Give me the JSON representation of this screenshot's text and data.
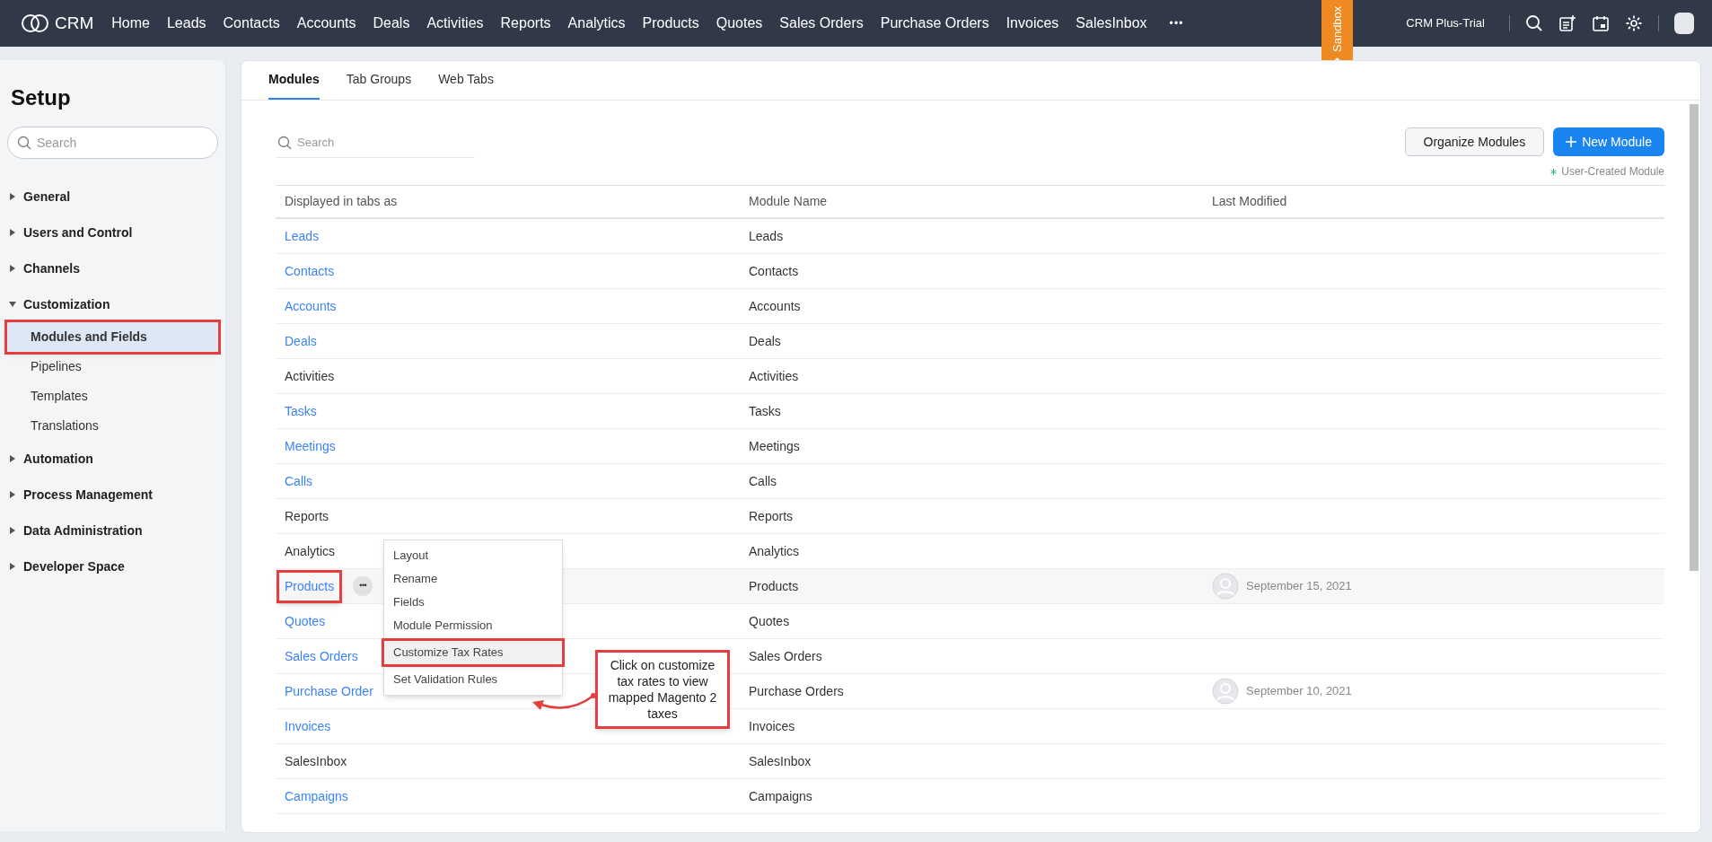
{
  "topbar": {
    "brand": "CRM",
    "nav": [
      "Home",
      "Leads",
      "Contacts",
      "Accounts",
      "Deals",
      "Activities",
      "Reports",
      "Analytics",
      "Products",
      "Quotes",
      "Sales Orders",
      "Purchase Orders",
      "Invoices",
      "SalesInbox"
    ],
    "more": "•••",
    "ribbon": "Sandbox",
    "plan": "CRM Plus-Trial"
  },
  "sidebar": {
    "title": "Setup",
    "search": {
      "placeholder": "Search"
    },
    "sections": [
      {
        "label": "General",
        "expanded": false
      },
      {
        "label": "Users and Control",
        "expanded": false
      },
      {
        "label": "Channels",
        "expanded": false
      },
      {
        "label": "Customization",
        "expanded": true,
        "children": [
          {
            "label": "Modules and Fields",
            "selected": true,
            "annotated": true
          },
          {
            "label": "Pipelines",
            "selected": false,
            "annotated": false
          },
          {
            "label": "Templates",
            "selected": false,
            "annotated": false
          },
          {
            "label": "Translations",
            "selected": false,
            "annotated": false
          }
        ]
      },
      {
        "label": "Automation",
        "expanded": false
      },
      {
        "label": "Process Management",
        "expanded": false
      },
      {
        "label": "Data Administration",
        "expanded": false
      },
      {
        "label": "Developer Space",
        "expanded": false
      }
    ]
  },
  "tabs": [
    {
      "label": "Modules",
      "selected": true
    },
    {
      "label": "Tab Groups",
      "selected": false
    },
    {
      "label": "Web Tabs",
      "selected": false
    }
  ],
  "search": {
    "placeholder": "Search"
  },
  "buttons": {
    "organize": "Organize Modules",
    "new": "New Module"
  },
  "legend": "User-Created Module",
  "table": {
    "columns": [
      "Displayed in tabs as",
      "Module Name",
      "Last Modified"
    ],
    "rows": [
      {
        "tab": "Leads",
        "kind": "link",
        "name": "Leads"
      },
      {
        "tab": "Contacts",
        "kind": "link",
        "name": "Contacts"
      },
      {
        "tab": "Accounts",
        "kind": "link",
        "name": "Accounts"
      },
      {
        "tab": "Deals",
        "kind": "link",
        "name": "Deals"
      },
      {
        "tab": "Activities",
        "kind": "text",
        "name": "Activities"
      },
      {
        "tab": "Tasks",
        "kind": "link",
        "name": "Tasks"
      },
      {
        "tab": "Meetings",
        "kind": "link",
        "name": "Meetings"
      },
      {
        "tab": "Calls",
        "kind": "link",
        "name": "Calls"
      },
      {
        "tab": "Reports",
        "kind": "text",
        "name": "Reports"
      },
      {
        "tab": "Analytics",
        "kind": "text",
        "name": "Analytics"
      },
      {
        "tab": "Products",
        "kind": "link",
        "name": "Products",
        "modified": "September 15, 2021",
        "selected": true,
        "annotated": true
      },
      {
        "tab": "Quotes",
        "kind": "link",
        "name": "Quotes"
      },
      {
        "tab": "Sales Orders",
        "kind": "link",
        "name": "Sales Orders"
      },
      {
        "tab": "Purchase Order",
        "kind": "link",
        "name": "Purchase Orders",
        "modified": "September 10, 2021"
      },
      {
        "tab": "Invoices",
        "kind": "link",
        "name": "Invoices"
      },
      {
        "tab": "SalesInbox",
        "kind": "text",
        "name": "SalesInbox"
      },
      {
        "tab": "Campaigns",
        "kind": "link",
        "name": "Campaigns"
      }
    ]
  },
  "context_menu": {
    "items": [
      {
        "label": "Layout",
        "annotated": false
      },
      {
        "label": "Rename",
        "annotated": false
      },
      {
        "label": "Fields",
        "annotated": false
      },
      {
        "label": "Module Permission",
        "annotated": false
      },
      {
        "label": "Customize Tax Rates",
        "annotated": true
      },
      {
        "label": "Set Validation Rules",
        "annotated": false
      }
    ]
  },
  "callout": "Click on customize tax rates to view mapped Magento 2 taxes"
}
